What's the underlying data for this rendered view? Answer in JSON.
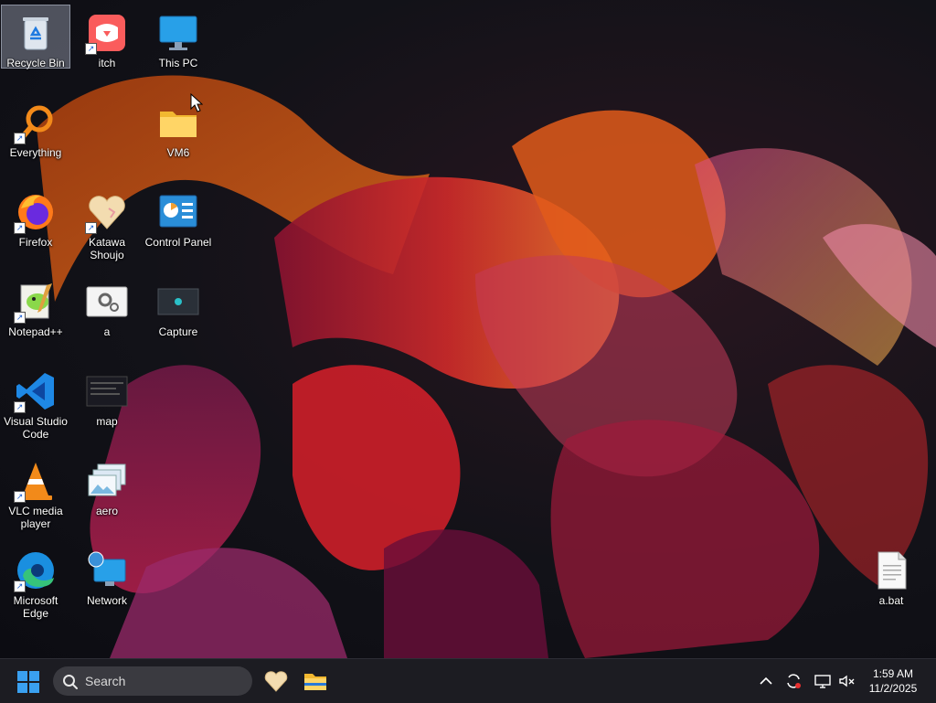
{
  "desktop": {
    "icons": [
      {
        "label": "Recycle Bin",
        "icon": "recycle-bin-icon"
      },
      {
        "label": "itch",
        "icon": "itch-icon"
      },
      {
        "label": "This PC",
        "icon": "this-pc-icon"
      },
      {
        "label": "Everything",
        "icon": "everything-icon"
      },
      {
        "label": "VM6",
        "icon": "folder-icon"
      },
      {
        "label": "Firefox",
        "icon": "firefox-icon"
      },
      {
        "label": "Katawa Shoujo",
        "icon": "heart-icon"
      },
      {
        "label": "Control Panel",
        "icon": "control-panel-icon"
      },
      {
        "label": "Notepad++",
        "icon": "notepad-plus-plus-icon"
      },
      {
        "label": "a",
        "icon": "settings-file-icon"
      },
      {
        "label": "Capture",
        "icon": "capture-icon"
      },
      {
        "label": "Visual Studio Code",
        "icon": "vscode-icon"
      },
      {
        "label": "map",
        "icon": "image-file-icon"
      },
      {
        "label": "VLC media player",
        "icon": "vlc-icon"
      },
      {
        "label": "aero",
        "icon": "image-stack-icon"
      },
      {
        "label": "Microsoft Edge",
        "icon": "edge-icon"
      },
      {
        "label": "Network",
        "icon": "network-icon"
      },
      {
        "label": "a.bat",
        "icon": "batch-file-icon"
      }
    ]
  },
  "taskbar": {
    "search_placeholder": "Search",
    "pinned": [
      {
        "name": "Katawa Shoujo",
        "icon": "heart-icon"
      },
      {
        "name": "File Explorer",
        "icon": "file-explorer-icon"
      }
    ],
    "tray": [
      "chevron-up-icon",
      "sync-icon",
      "network-icon",
      "volume-muted-icon"
    ],
    "time": "1:59 AM",
    "date": "11/2/2025"
  },
  "colors": {
    "taskbar_bg": "#1c1c22",
    "accent": "#0078d4"
  }
}
